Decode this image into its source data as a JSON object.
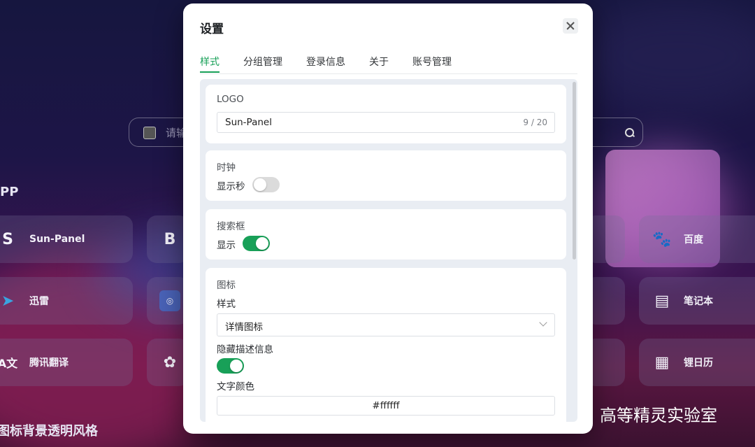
{
  "background": {
    "search": {
      "placeholder": "请输"
    },
    "group_title": "PP",
    "bottom_text": "图标背景透明风格",
    "apps": [
      {
        "label": "Sun-Panel",
        "icon": "sun-panel-logo-icon"
      },
      {
        "label": "",
        "icon": "blogger-icon"
      },
      {
        "label": "百度",
        "icon": "baidu-paw-icon"
      },
      {
        "label": "迅雷",
        "icon": "xunlei-bird-icon"
      },
      {
        "label": "",
        "icon": "openwrt-icon"
      },
      {
        "label": "笔记本",
        "icon": "notebook-icon"
      },
      {
        "label": "腾讯翻译",
        "icon": "translate-icon"
      },
      {
        "label": "",
        "icon": "openai-icon"
      },
      {
        "label": "锂日历",
        "icon": "calendar-icon"
      }
    ],
    "watermark": "高等精灵实验室"
  },
  "modal": {
    "title": "设置",
    "tabs": [
      {
        "label": "样式",
        "active": true
      },
      {
        "label": "分组管理",
        "active": false
      },
      {
        "label": "登录信息",
        "active": false
      },
      {
        "label": "关于",
        "active": false
      },
      {
        "label": "账号管理",
        "active": false
      }
    ],
    "logo_section": {
      "title": "LOGO",
      "value": "Sun-Panel",
      "count": "9 / 20"
    },
    "clock_section": {
      "title": "时钟",
      "show_seconds_label": "显示秒",
      "show_seconds": false
    },
    "search_section": {
      "title": "搜索框",
      "show_label": "显示",
      "show": true
    },
    "icon_section": {
      "title": "图标",
      "style_label": "样式",
      "style_value": "详情图标",
      "hide_desc_label": "隐藏描述信息",
      "hide_desc": true,
      "text_color_label": "文字颜色",
      "text_color_value": "#ffffff"
    }
  },
  "colors": {
    "accent": "#18a058",
    "text_color_value": "#ffffff"
  }
}
